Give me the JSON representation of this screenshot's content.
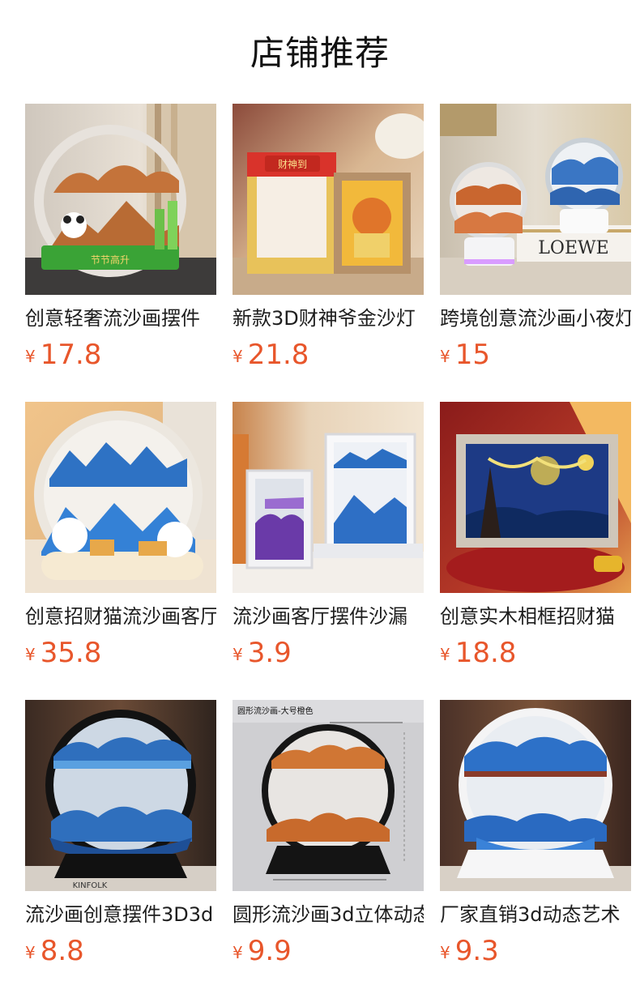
{
  "header": {
    "title": "店铺推荐"
  },
  "currency": "¥",
  "products": [
    {
      "name": "创意轻奢流沙画摆件",
      "price": "17.8",
      "image_label": "节节高升"
    },
    {
      "name": "新款3D财神爷金沙灯",
      "price": "21.8",
      "image_label": "财神到"
    },
    {
      "name": "跨境创意流沙画小夜灯",
      "price": "15",
      "image_label": "LOEWE"
    },
    {
      "name": "创意招财猫流沙画客厅",
      "price": "35.8",
      "image_label": ""
    },
    {
      "name": "流沙画客厅摆件沙漏",
      "price": "3.9",
      "image_label": ""
    },
    {
      "name": "创意实木相框招财猫",
      "price": "18.8",
      "image_label": ""
    },
    {
      "name": "流沙画创意摆件3D3d",
      "price": "8.8",
      "image_label": "KINFOLK"
    },
    {
      "name": "圆形流沙画3d立体动态",
      "price": "9.9",
      "image_label": "圆形流沙画-大号橙色"
    },
    {
      "name": "厂家直销3d动态艺术",
      "price": "9.3",
      "image_label": ""
    }
  ]
}
